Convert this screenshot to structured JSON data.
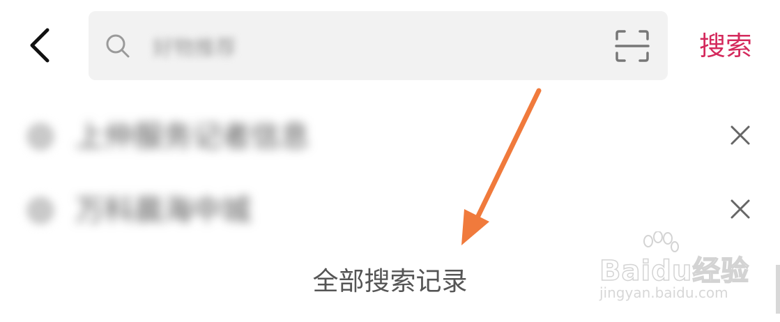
{
  "header": {
    "back_icon": "chevron-left-icon",
    "search": {
      "value": "好物推荐",
      "placeholder": "",
      "search_icon": "search-icon",
      "scan_icon": "scan-icon"
    },
    "search_button_label": "搜索"
  },
  "history": {
    "items": [
      {
        "label": "上仲服务记者信息"
      },
      {
        "label": "万科晨海中城"
      }
    ],
    "delete_icon": "close-icon",
    "all_history_label": "全部搜索记录"
  },
  "annotation": {
    "arrow_color": "#f07a3c"
  },
  "watermark": {
    "brand": "Baidu经验",
    "url": "jingyan.baidu.com"
  },
  "colors": {
    "accent": "#d4295c",
    "search_bg": "#f2f2f2",
    "text_secondary": "#555555"
  }
}
